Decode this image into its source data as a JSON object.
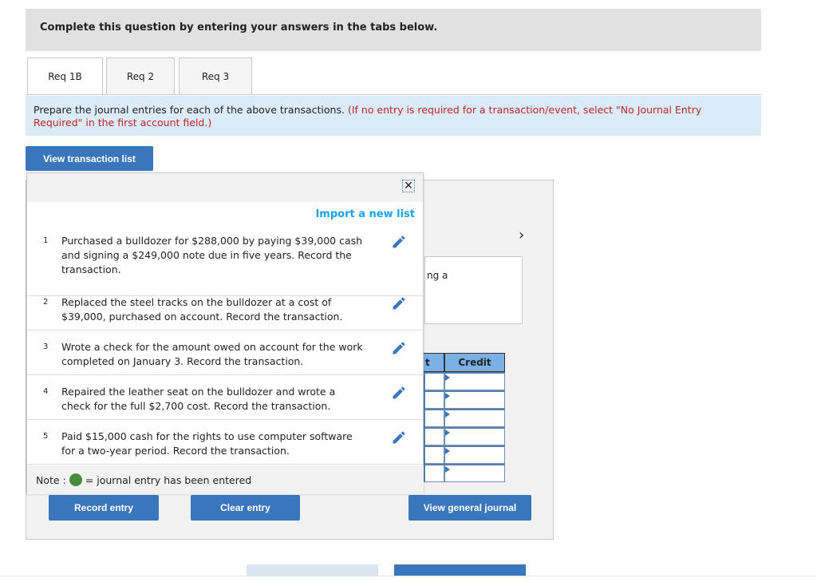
{
  "banner": "Complete this question by entering your answers in the tabs below.",
  "tabs": [
    {
      "label": "Req 1B",
      "active": true
    },
    {
      "label": "Req 2"
    },
    {
      "label": "Req 3"
    }
  ],
  "instruction": {
    "text": "Prepare the journal entries for each of the above transactions.",
    "note": "(If no entry is required for a transaction/event, select \"No Journal Entry Required\" in the first account field.)"
  },
  "view_transaction_list": "View transaction list",
  "panel": {
    "description_partial": "ng a",
    "columns": {
      "debit_partial": "t",
      "credit": "Credit"
    },
    "rows": 6,
    "next_icon": "chevron-right-icon"
  },
  "popup": {
    "import_label": "Import a new list",
    "close_icon": "close-icon",
    "transactions": [
      {
        "num": "1",
        "text": "Purchased a bulldozer for $288,000 by paying $39,000 cash and signing a $249,000 note due in five years. Record the transaction."
      },
      {
        "num": "2",
        "text": "Replaced the steel tracks on the bulldozer at a cost of $39,000, purchased on account. Record the transaction."
      },
      {
        "num": "3",
        "text": "Wrote a check for the amount owed on account for the work completed on January 3. Record the transaction."
      },
      {
        "num": "4",
        "text": "Repaired the leather seat on the bulldozer and wrote a check for the full $2,700 cost. Record the transaction."
      },
      {
        "num": "5",
        "text": "Paid $15,000 cash for the rights to use computer software for a two-year period. Record the transaction."
      }
    ],
    "note_prefix": "Note :",
    "note_suffix": "= journal entry has been entered"
  },
  "buttons": {
    "record": "Record entry",
    "clear": "Clear entry",
    "view_journal": "View general journal"
  },
  "colors": {
    "accent": "#3a76bc",
    "link": "#1aa3e8",
    "entered": "#4a8a3e"
  }
}
